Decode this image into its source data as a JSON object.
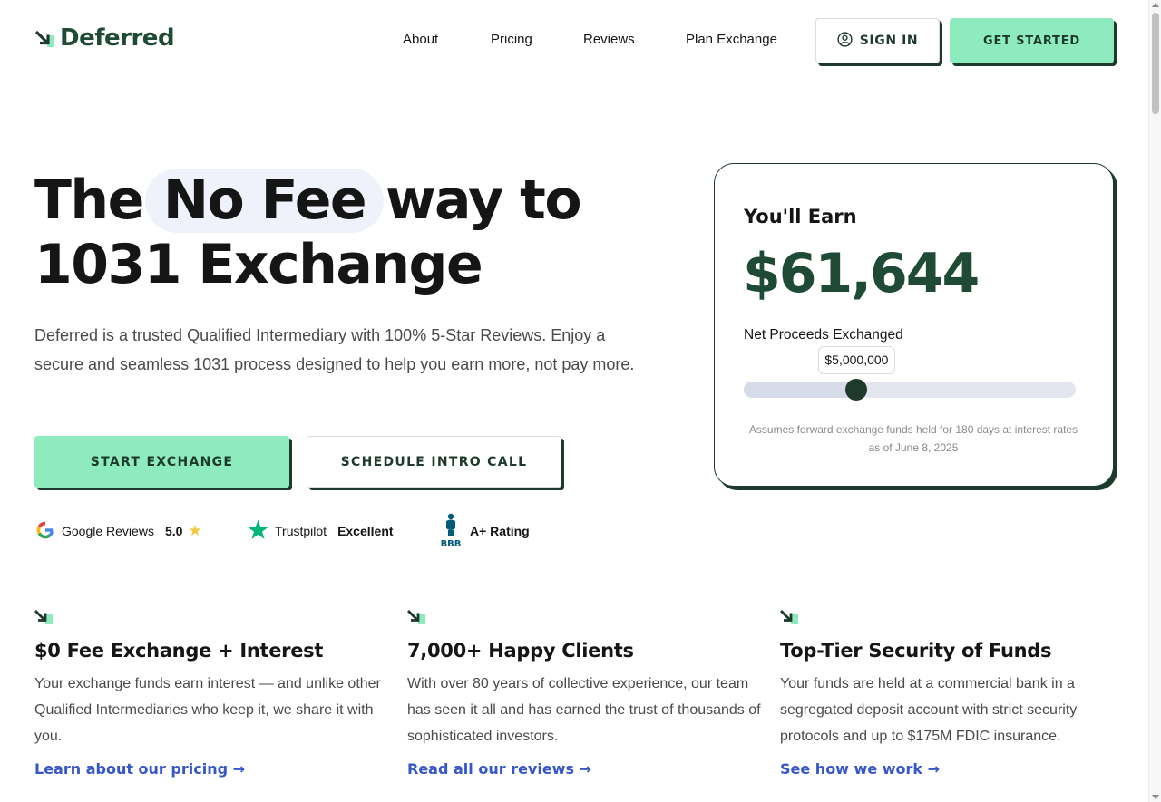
{
  "brand": {
    "logo_text": "Deferred",
    "accent": "#8eebbd",
    "dark_green": "#1e3a2d",
    "link_blue": "#3757c8"
  },
  "nav": {
    "about": "About",
    "pricing": "Pricing",
    "reviews": "Reviews",
    "plan_exchange": "Plan Exchange",
    "sign_in": "SIGN IN",
    "get_started": "GET STARTED"
  },
  "hero": {
    "title_prefix": "The",
    "title_highlight": "No Fee",
    "title_suffix": "way to",
    "title_line2": "1031 Exchange",
    "description": "Deferred is a trusted Qualified Intermediary with 100% 5-Star Reviews. Enjoy a secure and seamless 1031 process designed to help you earn more, not pay more.",
    "start_button": "START EXCHANGE",
    "call_button": "SCHEDULE INTRO CALL"
  },
  "ratings": {
    "google_label": "Google Reviews",
    "google_score": "5.0",
    "trustpilot_label": "Trustpilot",
    "trustpilot_score": "Excellent",
    "bbb_logo": "BBB",
    "bbb_score": "A+ Rating"
  },
  "calculator": {
    "heading": "You'll Earn",
    "amount": "$61,644",
    "label": "Net Proceeds Exchanged",
    "slider_value": "$5,000,000",
    "slider_fraction": 0.34,
    "note": "Assumes forward exchange funds held for 180 days at interest rates as of June 8, 2025"
  },
  "features": [
    {
      "title": "$0 Fee Exchange + Interest",
      "text": "Your exchange funds earn interest — and unlike other Qualified Intermediaries who keep it, we share it with you.",
      "link": "Learn about our pricing →"
    },
    {
      "title": "7,000+ Happy Clients",
      "text": "With over 80 years of collective experience, our team has seen it all and has earned the trust of thousands of sophisticated investors.",
      "link": "Read all our reviews →"
    },
    {
      "title": "Top-Tier Security of Funds",
      "text": "Your funds are held at a commercial bank in a segregated deposit account with strict security protocols and up to $175M FDIC insurance.",
      "link": "See how we work →"
    }
  ]
}
